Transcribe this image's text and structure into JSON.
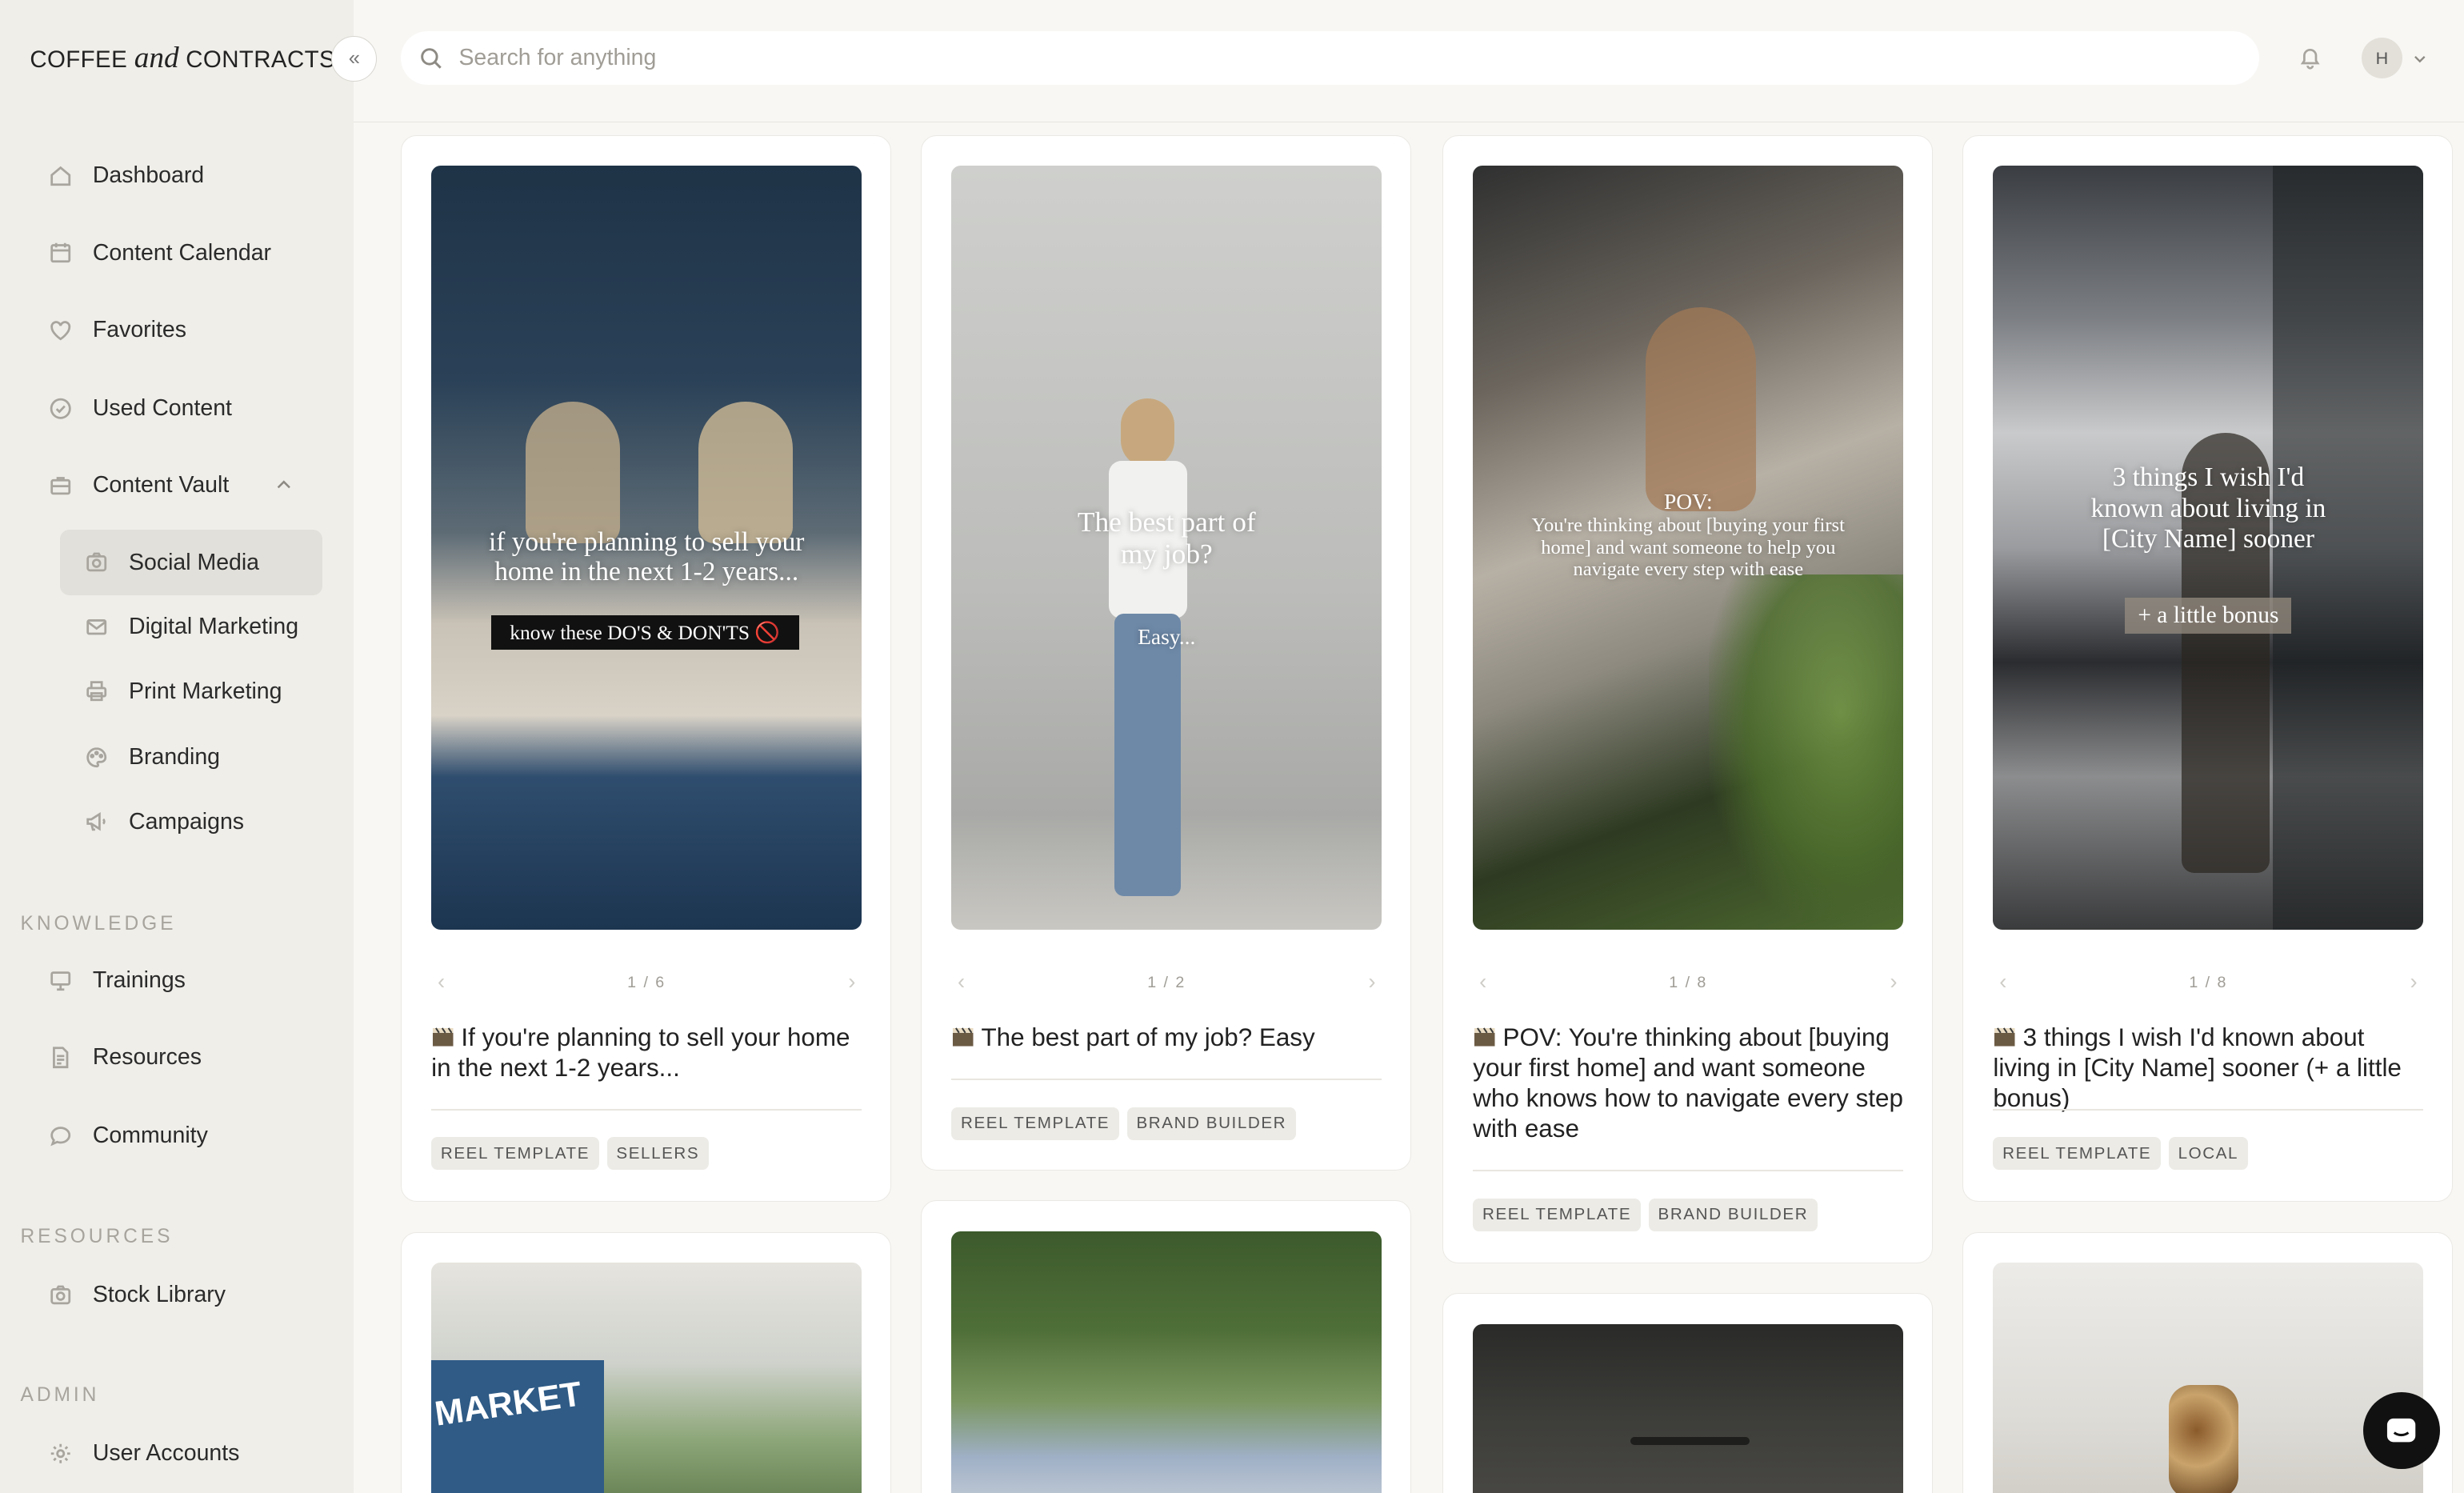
{
  "brand": {
    "pre": "COFFEE ",
    "mid": "and",
    "post": " CONTRACTS"
  },
  "sidebar": {
    "collapse_glyph": "«",
    "items": [
      {
        "label": "Dashboard",
        "icon": "home-icon"
      },
      {
        "label": "Content Calendar",
        "icon": "calendar-icon"
      },
      {
        "label": "Favorites",
        "icon": "heart-icon"
      },
      {
        "label": "Used Content",
        "icon": "check-circle-icon"
      },
      {
        "label": "Content Vault",
        "icon": "briefcase-icon"
      }
    ],
    "vault_items": [
      {
        "label": "Social Media",
        "icon": "camera-icon",
        "active": true
      },
      {
        "label": "Digital Marketing",
        "icon": "mail-icon"
      },
      {
        "label": "Print Marketing",
        "icon": "printer-icon"
      },
      {
        "label": "Branding",
        "icon": "palette-icon"
      },
      {
        "label": "Campaigns",
        "icon": "megaphone-icon"
      }
    ],
    "knowledge_label": "KNOWLEDGE",
    "knowledge_items": [
      {
        "label": "Trainings",
        "icon": "presentation-icon"
      },
      {
        "label": "Resources",
        "icon": "document-icon"
      },
      {
        "label": "Community",
        "icon": "chat-icon"
      }
    ],
    "resources_label": "RESOURCES",
    "resources_items": [
      {
        "label": "Stock Library",
        "icon": "camera-icon"
      }
    ],
    "admin_label": "ADMIN",
    "admin_items": [
      {
        "label": "User Accounts",
        "icon": "gear-icon"
      }
    ]
  },
  "search": {
    "placeholder": "Search for anything"
  },
  "user": {
    "initial": "H"
  },
  "cards": [
    {
      "overlay": "if you're planning to sell your home in the next 1-2 years...",
      "overlay_sub": "know these DO'S & DON'TS 🚫",
      "pager": "1 / 6",
      "title": "If you're planning to sell your home in the next 1-2 years...",
      "tags": [
        "REEL TEMPLATE",
        "SELLERS"
      ]
    },
    {
      "overlay": "The best part of my job?",
      "overlay_sub": "Easy...",
      "pager": "1 / 2",
      "title": "The best part of my job? Easy",
      "tags": [
        "REEL TEMPLATE",
        "BRAND BUILDER"
      ]
    },
    {
      "overlay": "POV:",
      "overlay_sub": "You're thinking about [buying your first home] and want someone to help you navigate every step with ease",
      "pager": "1 / 8",
      "title": "POV: You're thinking about [buying your first home] and want someone who knows how to navigate every step with ease",
      "tags": [
        "REEL TEMPLATE",
        "BRAND BUILDER"
      ]
    },
    {
      "overlay": "3 things I wish I'd known about living in [City Name] sooner",
      "overlay_sub": "+ a little bonus",
      "pager": "1 / 8",
      "title": "3 things I wish I'd known about living in [City Name] sooner (+ a little bonus)",
      "tags": [
        "REEL TEMPLATE",
        "LOCAL"
      ]
    }
  ],
  "second_row": {
    "sign_text": "MARKET"
  },
  "colors": {
    "sidebar_bg": "#efeee9",
    "page_bg": "#f8f7f4",
    "active_item": "#e2e0da",
    "tag_bg": "#ecebe6"
  }
}
